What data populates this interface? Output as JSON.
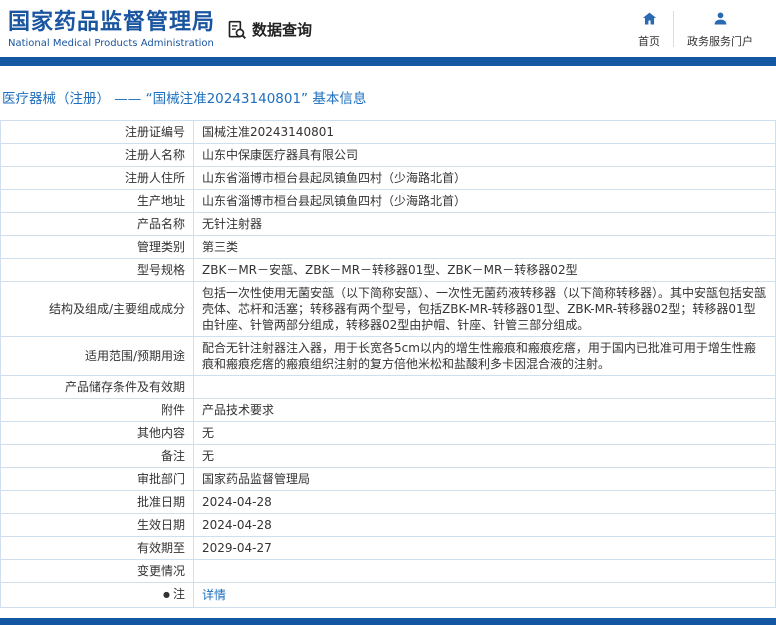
{
  "colors": {
    "brand_blue": "#1a55a0",
    "accent_bar": "#1356a2",
    "link_blue": "#1d6ebd",
    "table_border": "#cfdfee",
    "text": "#333333"
  },
  "header": {
    "logo_title": "国家药品监督管理局",
    "logo_subtitle": "National Medical Products Administration",
    "data_query_label": "数据查询",
    "home_label": "首页",
    "portal_label": "政务服务门户"
  },
  "icons": {
    "data_query": "document-magnifier-icon",
    "home": "home-icon",
    "portal": "user-icon",
    "note": "dot-icon"
  },
  "page_title": {
    "text": "医疗器械（注册） ——  “国械注准20243140801”  基本信息"
  },
  "table": {
    "rows": [
      {
        "label": "注册证编号",
        "value": "国械注准20243140801"
      },
      {
        "label": "注册人名称",
        "value": "山东中保康医疗器具有限公司"
      },
      {
        "label": "注册人住所",
        "value": "山东省淄博市桓台县起凤镇鱼四村（少海路北首）"
      },
      {
        "label": "生产地址",
        "value": "山东省淄博市桓台县起凤镇鱼四村（少海路北首）"
      },
      {
        "label": "产品名称",
        "value": "无针注射器"
      },
      {
        "label": "管理类别",
        "value": "第三类"
      },
      {
        "label": "型号规格",
        "value": "ZBK－MR－安瓿、ZBK－MR－转移器01型、ZBK－MR－转移器02型"
      },
      {
        "label": "结构及组成/主要组成成分",
        "value": "包括一次性使用无菌安瓿（以下简称安瓿）、一次性无菌药液转移器（以下简称转移器）。其中安瓿包括安瓿壳体、芯杆和活塞；转移器有两个型号，包括ZBK-MR-转移器01型、ZBK-MR-转移器02型；转移器01型由针座、针管两部分组成，转移器02型由护帽、针座、针管三部分组成。"
      },
      {
        "label": "适用范围/预期用途",
        "value": "配合无针注射器注入器，用于长宽各5cm以内的增生性瘢痕和瘢痕疙瘩，用于国内已批准可用于增生性瘢痕和瘢痕疙瘩的瘢痕组织注射的复方倍他米松和盐酸利多卡因混合液的注射。"
      },
      {
        "label": "产品储存条件及有效期",
        "value": ""
      },
      {
        "label": "附件",
        "value": "产品技术要求"
      },
      {
        "label": "其他内容",
        "value": "无"
      },
      {
        "label": "备注",
        "value": "无"
      },
      {
        "label": "审批部门",
        "value": "国家药品监督管理局"
      },
      {
        "label": "批准日期",
        "value": "2024-04-28"
      },
      {
        "label": "生效日期",
        "value": "2024-04-28"
      },
      {
        "label": "有效期至",
        "value": "2029-04-27"
      },
      {
        "label": "变更情况",
        "value": ""
      },
      {
        "label": "注",
        "value": "详情",
        "bullet": true,
        "link": true
      }
    ]
  }
}
